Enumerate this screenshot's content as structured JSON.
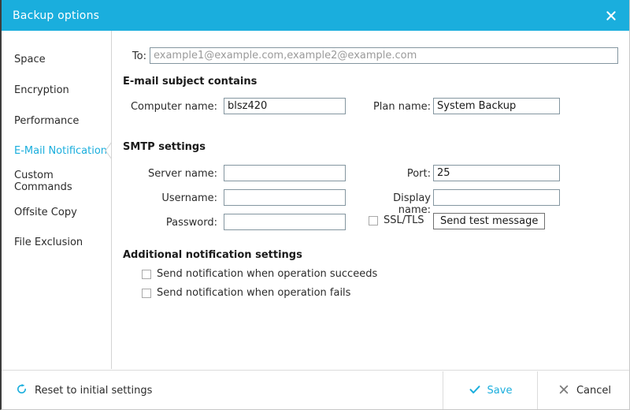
{
  "window": {
    "title": "Backup options",
    "close_icon": "close-icon",
    "accent_color": "#1aaedd",
    "titlebar_text_color": "#ffffff"
  },
  "sidebar": {
    "items": [
      {
        "label": "Space",
        "active": false
      },
      {
        "label": "Encryption",
        "active": false
      },
      {
        "label": "Performance",
        "active": false
      },
      {
        "label": "E-Mail Notification",
        "active": true
      },
      {
        "label": "Custom Commands",
        "active": false
      },
      {
        "label": "Offsite Copy",
        "active": false
      },
      {
        "label": "File Exclusion",
        "active": false
      }
    ]
  },
  "main": {
    "to": {
      "label": "To:",
      "value": "",
      "placeholder": "example1@example.com,example2@example.com"
    },
    "subject_section": {
      "title": "E-mail subject contains",
      "computer_name": {
        "label": "Computer name:",
        "value": "blsz420",
        "placeholder": ""
      },
      "plan_name": {
        "label": "Plan name:",
        "value": "System Backup",
        "placeholder": ""
      }
    },
    "smtp_section": {
      "title": "SMTP settings",
      "server_name": {
        "label": "Server name:",
        "value": "",
        "placeholder": ""
      },
      "port": {
        "label": "Port:",
        "value": "25",
        "placeholder": ""
      },
      "username": {
        "label": "Username:",
        "value": "",
        "placeholder": ""
      },
      "display_name": {
        "label": "Display name:",
        "value": "",
        "placeholder": ""
      },
      "password": {
        "label": "Password:",
        "value": "",
        "placeholder": ""
      },
      "ssl_tls": {
        "label": "SSL/TLS",
        "checked": false
      },
      "send_test_button": "Send test message"
    },
    "additional_section": {
      "title": "Additional notification settings",
      "options": [
        {
          "label": "Send notification when operation succeeds",
          "checked": false
        },
        {
          "label": "Send notification when operation fails",
          "checked": false
        }
      ]
    }
  },
  "footer": {
    "reset": {
      "label": "Reset to initial settings",
      "icon": "reset-circular-arrow-icon"
    },
    "save": {
      "label": "Save",
      "icon": "check-icon"
    },
    "cancel": {
      "label": "Cancel",
      "icon": "x-icon"
    }
  }
}
